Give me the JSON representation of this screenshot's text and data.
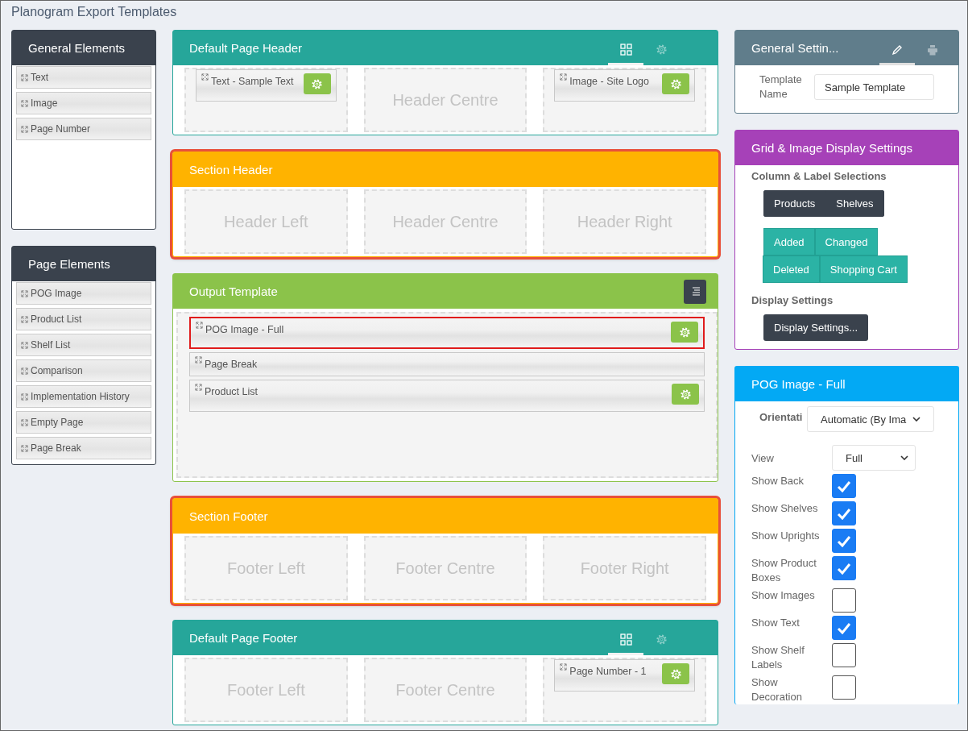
{
  "title": "Planogram Export Templates",
  "general_elements": {
    "title": "General Elements",
    "items": [
      "Text",
      "Image",
      "Page Number"
    ]
  },
  "page_elements": {
    "title": "Page Elements",
    "items": [
      "POG Image",
      "Product List",
      "Shelf List",
      "Comparison",
      "Implementation History",
      "Empty Page",
      "Page Break"
    ]
  },
  "sections": [
    {
      "kind": "page_band",
      "title": "Default Page Header",
      "tabs": [
        {
          "kind": "layout",
          "selected": true
        },
        {
          "kind": "settings",
          "selected": false
        }
      ],
      "slots": [
        {
          "element": "Text - Sample Text"
        },
        {
          "placeholder": "Header Centre"
        },
        {
          "element": "Image - Site Logo"
        }
      ]
    },
    {
      "kind": "section_band",
      "title": "Section Header",
      "highlighted": true,
      "slots": [
        {
          "placeholder": "Header Left"
        },
        {
          "placeholder": "Header Centre"
        },
        {
          "placeholder": "Header Right"
        }
      ]
    },
    {
      "kind": "output",
      "title": "Output Template",
      "items": [
        {
          "label": "POG Image - Full",
          "selected": true,
          "configurable": true
        },
        {
          "label": "Page Break",
          "selected": false,
          "configurable": false
        },
        {
          "label": "Product List",
          "selected": false,
          "configurable": true
        }
      ]
    },
    {
      "kind": "section_band",
      "title": "Section Footer",
      "highlighted": true,
      "slots": [
        {
          "placeholder": "Footer Left"
        },
        {
          "placeholder": "Footer Centre"
        },
        {
          "placeholder": "Footer Right"
        }
      ]
    },
    {
      "kind": "page_band",
      "title": "Default Page Footer",
      "tabs": [
        {
          "kind": "layout",
          "selected": true
        },
        {
          "kind": "settings",
          "selected": false
        }
      ],
      "slots": [
        {
          "placeholder": "Footer Left"
        },
        {
          "placeholder": "Footer Centre"
        },
        {
          "element": "Page Number - 1"
        }
      ]
    }
  ],
  "general_settings": {
    "title": "General Settin...",
    "tabs": [
      {
        "kind": "edit",
        "selected": true
      },
      {
        "kind": "print",
        "selected": false
      }
    ],
    "name_label": "Template Name",
    "name_value": "Sample Template"
  },
  "grid_settings": {
    "title": "Grid & Image Display Settings",
    "column_heading": "Column & Label Selections",
    "column_buttons": [
      "Products",
      "Shelves"
    ],
    "change_rows": [
      [
        "Added",
        "Changed"
      ],
      [
        "Deleted",
        "Shopping Cart"
      ]
    ],
    "display_heading": "Display Settings",
    "display_button": "Display Settings..."
  },
  "pog_image_panel": {
    "title": "POG Image - Full",
    "orientation_label": "Orientati",
    "orientation_value": "Automatic (By Ima",
    "view_label": "View",
    "view_value": "Full",
    "options": [
      {
        "label": "Show Back",
        "checked": true
      },
      {
        "label": "Show Shelves",
        "checked": true
      },
      {
        "label": "Show Uprights",
        "checked": true
      },
      {
        "label": "Show Product Boxes",
        "checked": true
      },
      {
        "label": "Show Images",
        "checked": false
      },
      {
        "label": "Show Text",
        "checked": true
      },
      {
        "label": "Show Shelf Labels",
        "checked": false
      },
      {
        "label": "Show Decoration",
        "checked": false
      }
    ]
  }
}
